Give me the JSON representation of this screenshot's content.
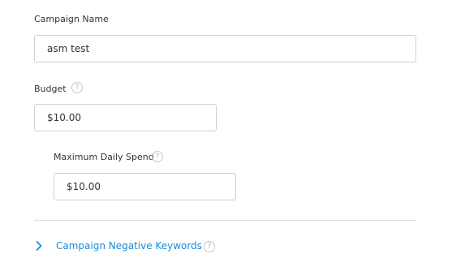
{
  "form": {
    "campaign_name": {
      "label": "Campaign Name",
      "value": "asm test"
    },
    "budget": {
      "label": "Budget",
      "value": "$10.00",
      "help_icon": "question-circle-icon"
    },
    "max_daily_spend": {
      "label": "Maximum Daily Spend",
      "value": "$10.00",
      "help_icon": "question-circle-icon"
    },
    "negative_keywords": {
      "label": "Campaign Negative Keywords",
      "chevron_icon": "chevron-right-icon",
      "help_icon": "question-circle-icon",
      "link_color": "#1a8ad9"
    }
  },
  "help_glyph": "?"
}
